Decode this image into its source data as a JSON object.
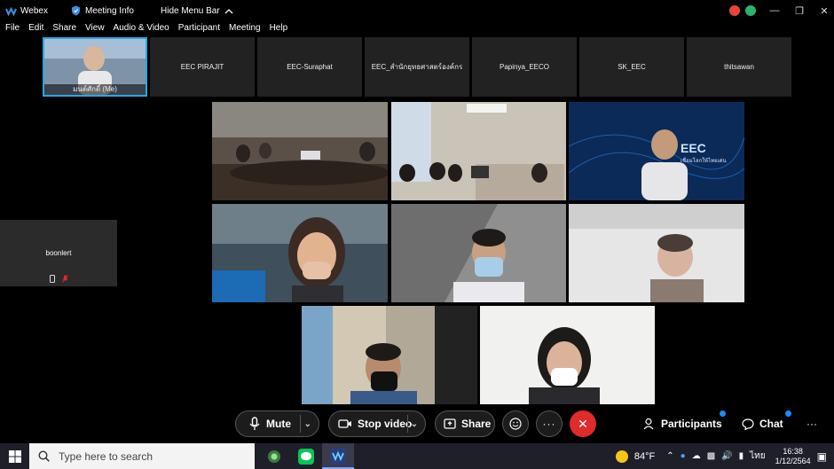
{
  "titlebar": {
    "app_name": "Webex",
    "meeting_info": "Meeting Info",
    "hide_menu": "Hide Menu Bar"
  },
  "menu": [
    "File",
    "Edit",
    "Share",
    "View",
    "Audio & Video",
    "Participant",
    "Meeting",
    "Help"
  ],
  "filmstrip": {
    "me_label": "มนต์ศักดิ์ (Me)",
    "names": [
      "EEC PIRAJIT",
      "EEC-Suraphat",
      "EEC_สำนักยุทธศาสตร์องค์กร",
      "Papinya_EECO",
      "SK_EEC",
      "thitsawan"
    ]
  },
  "side_tile": {
    "name": "boonlert"
  },
  "tile_overlay": {
    "eec_text": "EEC",
    "eec_sub": "เชื่อมโลกให้ไทยเด่น"
  },
  "controls": {
    "mute": "Mute",
    "stop_video": "Stop video",
    "share": "Share",
    "participants": "Participants",
    "chat": "Chat"
  },
  "taskbar": {
    "search_placeholder": "Type here to search",
    "temperature": "84°F",
    "language": "ไทย",
    "time": "16:38",
    "date": "1/12/2564"
  },
  "colors": {
    "accent": "#27a9e1",
    "end_call": "#e02b2b",
    "badge": "#1a8cff"
  }
}
